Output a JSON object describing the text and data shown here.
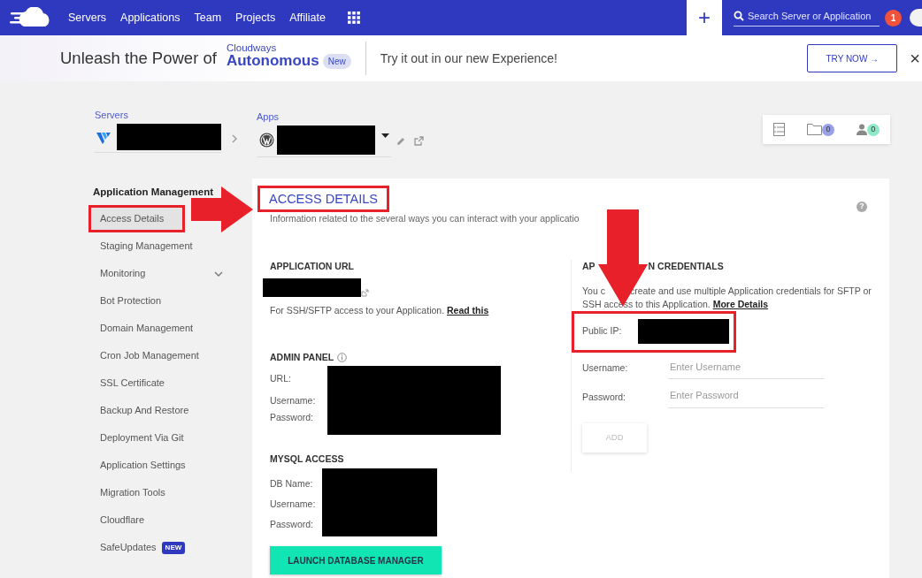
{
  "nav": {
    "links": [
      "Servers",
      "Applications",
      "Team",
      "Projects",
      "Affiliate"
    ],
    "plus": "+",
    "search": {
      "placeholder": "Search Server or Application"
    },
    "notification_count": "1"
  },
  "banner": {
    "lead": "Unleash the Power of",
    "brand_small": "Cloudways",
    "brand": "Autonomous",
    "badge": "New",
    "message": "Try it out in our new Experience!",
    "button": "TRY NOW →",
    "close": "×"
  },
  "breadcrumb": {
    "servers_label": "Servers",
    "apps_label": "Apps"
  },
  "toolbar_counts": [
    "0",
    "0"
  ],
  "sidebar": {
    "heading": "Application Management",
    "items": [
      {
        "label": "Access Details",
        "selected": true,
        "highlighted": true,
        "has_submenu": false
      },
      {
        "label": "Staging Management",
        "selected": false,
        "highlighted": false,
        "has_submenu": false
      },
      {
        "label": "Monitoring",
        "selected": false,
        "highlighted": false,
        "has_submenu": true
      },
      {
        "label": "Bot Protection",
        "selected": false,
        "highlighted": false,
        "has_submenu": false
      },
      {
        "label": "Domain Management",
        "selected": false,
        "highlighted": false,
        "has_submenu": false
      },
      {
        "label": "Cron Job Management",
        "selected": false,
        "highlighted": false,
        "has_submenu": false
      },
      {
        "label": "SSL Certificate",
        "selected": false,
        "highlighted": false,
        "has_submenu": false
      },
      {
        "label": "Backup And Restore",
        "selected": false,
        "highlighted": false,
        "has_submenu": false
      },
      {
        "label": "Deployment Via Git",
        "selected": false,
        "highlighted": false,
        "has_submenu": false
      },
      {
        "label": "Application Settings",
        "selected": false,
        "highlighted": false,
        "has_submenu": false
      },
      {
        "label": "Migration Tools",
        "selected": false,
        "highlighted": false,
        "has_submenu": false
      },
      {
        "label": "Cloudflare",
        "selected": false,
        "highlighted": false,
        "has_submenu": false
      },
      {
        "label": "SafeUpdates",
        "selected": false,
        "highlighted": false,
        "has_submenu": false,
        "badge": "NEW"
      }
    ]
  },
  "main": {
    "title": "ACCESS DETAILS",
    "help": "?",
    "title_highlighted": true,
    "description": "Information related to the several ways you can interact with your applicatio",
    "app_url": {
      "heading": "APPLICATION URL",
      "note": "For SSH/SFTP access to your Application.",
      "link": "Read this"
    },
    "admin_panel": {
      "heading": "ADMIN PANEL",
      "fields": [
        "URL:",
        "Username:",
        "Password:"
      ]
    },
    "mysql": {
      "heading": "MYSQL ACCESS",
      "fields": [
        "DB Name:",
        "Username:",
        "Password:"
      ],
      "button": "LAUNCH DATABASE MANAGER"
    },
    "credentials": {
      "heading_parts": [
        "AP",
        "N CREDENTIALS"
      ],
      "description_parts": [
        "You c",
        "create and use multiple Application credentials for SFTP or SSH access to this Application."
      ],
      "link": "More Details",
      "public_ip_label": "Public IP:",
      "public_ip_highlighted": true,
      "fields": [
        {
          "label": "Username:",
          "placeholder": "Enter Username"
        },
        {
          "label": "Password:",
          "placeholder": "Enter Password"
        }
      ],
      "button": "ADD",
      "button_disabled": true
    }
  }
}
